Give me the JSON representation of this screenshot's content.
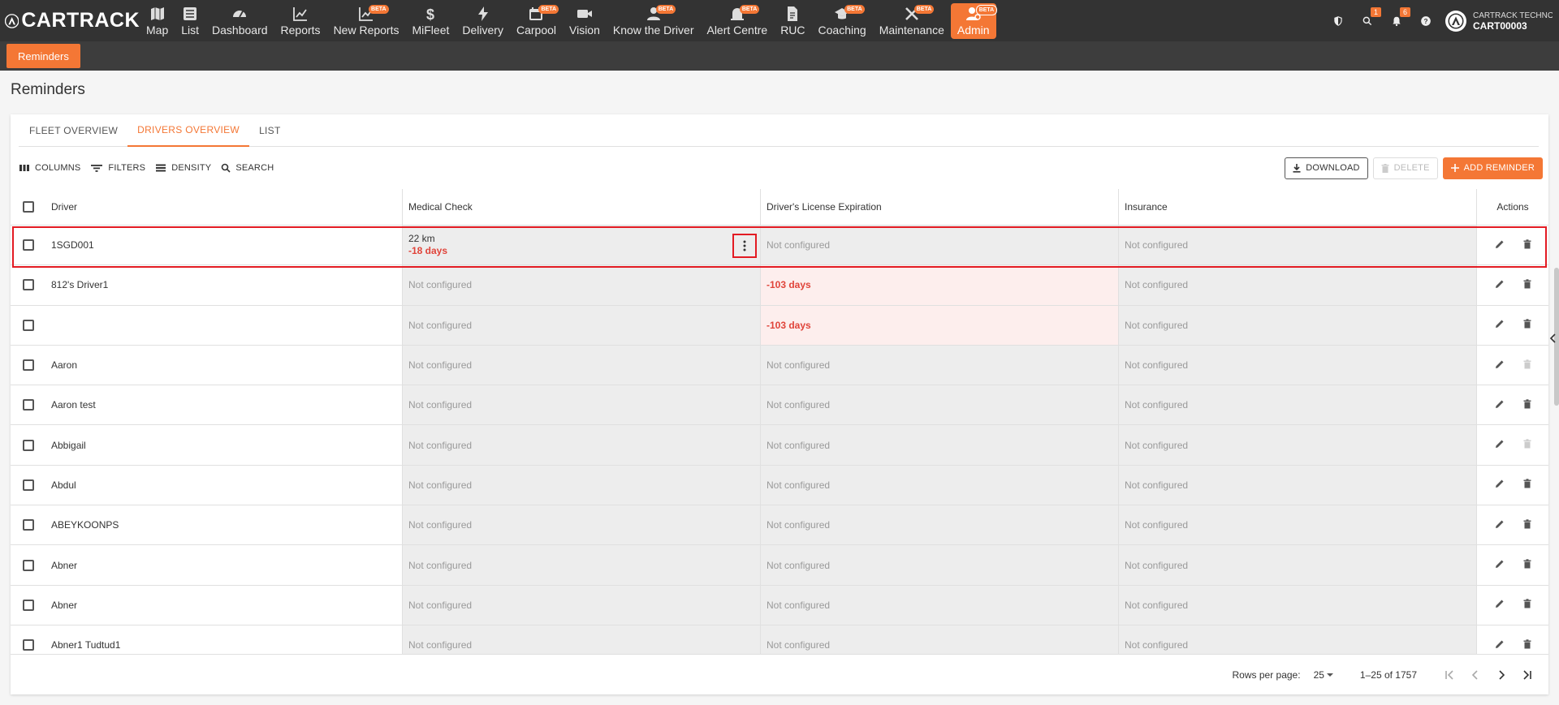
{
  "brand": {
    "name": "CARTRACK",
    "accent": "#f47735"
  },
  "nav": {
    "items": [
      {
        "key": "map",
        "label": "Map",
        "icon": "map-icon",
        "beta": false
      },
      {
        "key": "list",
        "label": "List",
        "icon": "list-icon",
        "beta": false
      },
      {
        "key": "dashboard",
        "label": "Dashboard",
        "icon": "dashboard-icon",
        "beta": false
      },
      {
        "key": "reports",
        "label": "Reports",
        "icon": "reports-icon",
        "beta": false
      },
      {
        "key": "new-reports",
        "label": "New Reports",
        "icon": "new-reports-icon",
        "beta": true
      },
      {
        "key": "mifleet",
        "label": "MiFleet",
        "icon": "dollar-icon",
        "beta": false
      },
      {
        "key": "delivery",
        "label": "Delivery",
        "icon": "bolt-icon",
        "beta": false
      },
      {
        "key": "carpool",
        "label": "Carpool",
        "icon": "calendar-icon",
        "beta": true
      },
      {
        "key": "vision",
        "label": "Vision",
        "icon": "camera-icon",
        "beta": false
      },
      {
        "key": "know-the-driver",
        "label": "Know the Driver",
        "icon": "driver-icon",
        "beta": true
      },
      {
        "key": "alert-centre",
        "label": "Alert Centre",
        "icon": "alert-icon",
        "beta": true
      },
      {
        "key": "ruc",
        "label": "RUC",
        "icon": "document-icon",
        "beta": false
      },
      {
        "key": "coaching",
        "label": "Coaching",
        "icon": "graduation-cap-icon",
        "beta": true
      },
      {
        "key": "maintenance",
        "label": "Maintenance",
        "icon": "wrench-icon",
        "beta": true
      },
      {
        "key": "admin",
        "label": "Admin",
        "icon": "admin-user-icon",
        "beta": true,
        "active": true
      }
    ],
    "beta_label": "BETA",
    "right": {
      "search_badge": "1",
      "notifications_badge": "6",
      "account_company": "CARTRACK TECHNOL...",
      "account_id": "CART00003"
    }
  },
  "subnav": {
    "active_tab": "Reminders"
  },
  "page": {
    "title": "Reminders"
  },
  "tabs": [
    {
      "label": "FLEET OVERVIEW",
      "active": false
    },
    {
      "label": "DRIVERS OVERVIEW",
      "active": true
    },
    {
      "label": "LIST",
      "active": false
    }
  ],
  "toolbar": {
    "columns": "COLUMNS",
    "filters": "FILTERS",
    "density": "DENSITY",
    "search": "SEARCH",
    "download": "DOWNLOAD",
    "delete": "DELETE",
    "add_reminder": "ADD REMINDER"
  },
  "table": {
    "headers": {
      "driver": "Driver",
      "medical": "Medical Check",
      "license": "Driver's License Expiration",
      "insurance": "Insurance",
      "actions": "Actions"
    },
    "rows": [
      {
        "driver": "1SGD001",
        "medical": {
          "value": "22 km",
          "days": "-18 days"
        },
        "license": "Not configured",
        "insurance": "Not configured",
        "delete_enabled": true,
        "selected": true
      },
      {
        "driver": "812's Driver1",
        "medical": "Not configured",
        "license": "-103 days",
        "insurance": "Not configured",
        "delete_enabled": true
      },
      {
        "driver": "",
        "medical": "Not configured",
        "license": "-103 days",
        "insurance": "Not configured",
        "delete_enabled": true
      },
      {
        "driver": "Aaron",
        "medical": "Not configured",
        "license": "Not configured",
        "insurance": "Not configured",
        "delete_enabled": false
      },
      {
        "driver": "Aaron test",
        "medical": "Not configured",
        "license": "Not configured",
        "insurance": "Not configured",
        "delete_enabled": true
      },
      {
        "driver": "Abbigail",
        "medical": "Not configured",
        "license": "Not configured",
        "insurance": "Not configured",
        "delete_enabled": false
      },
      {
        "driver": "Abdul",
        "medical": "Not configured",
        "license": "Not configured",
        "insurance": "Not configured",
        "delete_enabled": true
      },
      {
        "driver": "ABEYKOONPS",
        "medical": "Not configured",
        "license": "Not configured",
        "insurance": "Not configured",
        "delete_enabled": true
      },
      {
        "driver": "Abner",
        "medical": "Not configured",
        "license": "Not configured",
        "insurance": "Not configured",
        "delete_enabled": true
      },
      {
        "driver": "Abner",
        "medical": "Not configured",
        "license": "Not configured",
        "insurance": "Not configured",
        "delete_enabled": true
      },
      {
        "driver": "Abner1 Tudtud1",
        "medical": "Not configured",
        "license": "Not configured",
        "insurance": "Not configured",
        "delete_enabled": true
      }
    ]
  },
  "pagination": {
    "rows_per_page_label": "Rows per page:",
    "rows_per_page": "25",
    "range": "1–25 of 1757"
  }
}
